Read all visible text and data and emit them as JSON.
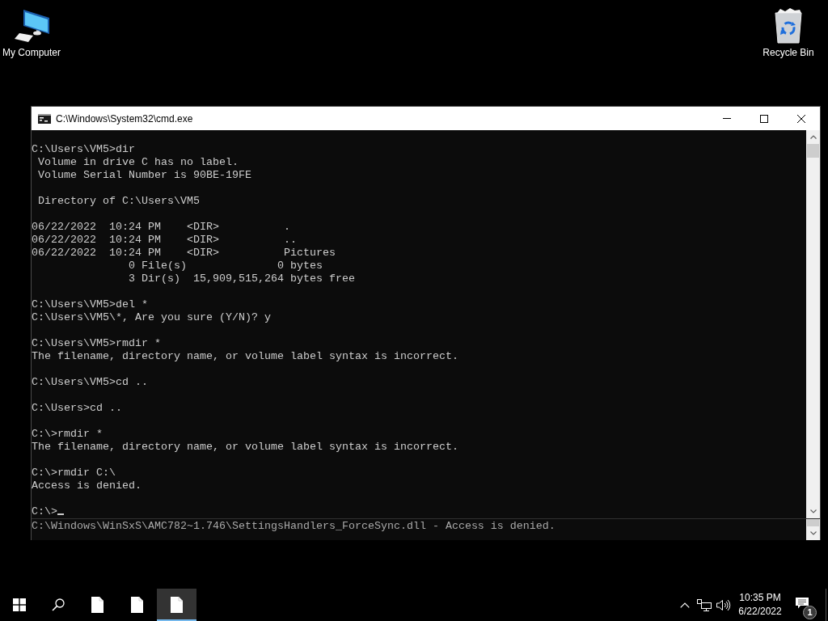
{
  "desktop_icons": [
    {
      "kind": "computer",
      "label": "My Computer"
    },
    {
      "kind": "recycle_bin",
      "label": "Recycle Bin"
    }
  ],
  "window": {
    "title": "C:\\Windows\\System32\\cmd.exe"
  },
  "console": {
    "blocks": [
      [
        "C:\\Users\\VM5>dir",
        " Volume in drive C has no label.",
        " Volume Serial Number is 90BE-19FE"
      ],
      [
        " Directory of C:\\Users\\VM5"
      ],
      [
        "06/22/2022  10:24 PM    <DIR>          .",
        "06/22/2022  10:24 PM    <DIR>          ..",
        "06/22/2022  10:24 PM    <DIR>          Pictures",
        "               0 File(s)              0 bytes",
        "               3 Dir(s)  15,909,515,264 bytes free"
      ],
      [
        "C:\\Users\\VM5>del *",
        "C:\\Users\\VM5\\*, Are you sure (Y/N)? y"
      ],
      [
        "C:\\Users\\VM5>rmdir *",
        "The filename, directory name, or volume label syntax is incorrect."
      ],
      [
        "C:\\Users\\VM5>cd .."
      ],
      [
        "C:\\Users>cd .."
      ],
      [
        "C:\\>rmdir *",
        "The filename, directory name, or volume label syntax is incorrect."
      ],
      [
        "C:\\>rmdir C:\\",
        "Access is denied."
      ]
    ],
    "prompt": "C:\\>"
  },
  "lower_pane": {
    "line": "C:\\Windows\\WinSxS\\AMC782~1.746\\SettingsHandlers_ForceSync.dll - Access is denied."
  },
  "taskbar": {
    "apps": [
      {
        "selected": false
      },
      {
        "selected": false
      },
      {
        "selected": true
      }
    ],
    "clock": {
      "time": "10:35 PM",
      "date": "6/22/2022"
    },
    "notification_count": "1"
  }
}
